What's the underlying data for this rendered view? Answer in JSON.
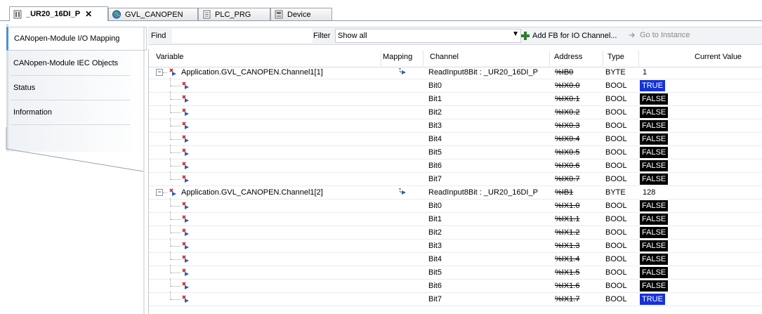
{
  "tabs": [
    {
      "label": "_UR20_16DI_P",
      "icon": "module-icon",
      "active": true,
      "close": "✕"
    },
    {
      "label": "GVL_CANOPEN",
      "icon": "globe-icon",
      "active": false
    },
    {
      "label": "PLC_PRG",
      "icon": "document-icon",
      "active": false
    },
    {
      "label": "Device",
      "icon": "device-icon",
      "active": false
    }
  ],
  "nav": {
    "items": [
      {
        "label": "CANopen-Module I/O Mapping",
        "active": true
      },
      {
        "label": "CANopen-Module IEC Objects",
        "active": false
      },
      {
        "label": "Status",
        "active": false
      },
      {
        "label": "Information",
        "active": false
      }
    ]
  },
  "toolbar": {
    "find_label": "Find",
    "find_value": "",
    "filter_label": "Filter",
    "filter_value": "Show all",
    "add_fb_label": "Add FB for IO Channel...",
    "goto_label": "Go to Instance"
  },
  "grid": {
    "columns": {
      "variable": "Variable",
      "mapping": "Mapping",
      "channel": "Channel",
      "address": "Address",
      "type": "Type",
      "current_value": "Current Value"
    },
    "rows": [
      {
        "variable": "Application.GVL_CANOPEN.Channel1[1]",
        "parent": true,
        "channel": "ReadInput8Bit : _UR20_16DI_P",
        "address": "%IB0",
        "type": "BYTE",
        "value": "1",
        "badge": ""
      },
      {
        "variable": "",
        "parent": false,
        "channel": "Bit0",
        "address": "%IX0.0",
        "type": "BOOL",
        "value": "TRUE",
        "badge": "true"
      },
      {
        "variable": "",
        "parent": false,
        "channel": "Bit1",
        "address": "%IX0.1",
        "type": "BOOL",
        "value": "FALSE",
        "badge": "false"
      },
      {
        "variable": "",
        "parent": false,
        "channel": "Bit2",
        "address": "%IX0.2",
        "type": "BOOL",
        "value": "FALSE",
        "badge": "false"
      },
      {
        "variable": "",
        "parent": false,
        "channel": "Bit3",
        "address": "%IX0.3",
        "type": "BOOL",
        "value": "FALSE",
        "badge": "false"
      },
      {
        "variable": "",
        "parent": false,
        "channel": "Bit4",
        "address": "%IX0.4",
        "type": "BOOL",
        "value": "FALSE",
        "badge": "false"
      },
      {
        "variable": "",
        "parent": false,
        "channel": "Bit5",
        "address": "%IX0.5",
        "type": "BOOL",
        "value": "FALSE",
        "badge": "false"
      },
      {
        "variable": "",
        "parent": false,
        "channel": "Bit6",
        "address": "%IX0.6",
        "type": "BOOL",
        "value": "FALSE",
        "badge": "false"
      },
      {
        "variable": "",
        "parent": false,
        "channel": "Bit7",
        "address": "%IX0.7",
        "type": "BOOL",
        "value": "FALSE",
        "badge": "false"
      },
      {
        "variable": "Application.GVL_CANOPEN.Channel1[2]",
        "parent": true,
        "channel": "ReadInput8Bit : _UR20_16DI_P",
        "address": "%IB1",
        "type": "BYTE",
        "value": "128",
        "badge": ""
      },
      {
        "variable": "",
        "parent": false,
        "channel": "Bit0",
        "address": "%IX1.0",
        "type": "BOOL",
        "value": "FALSE",
        "badge": "false"
      },
      {
        "variable": "",
        "parent": false,
        "channel": "Bit1",
        "address": "%IX1.1",
        "type": "BOOL",
        "value": "FALSE",
        "badge": "false"
      },
      {
        "variable": "",
        "parent": false,
        "channel": "Bit2",
        "address": "%IX1.2",
        "type": "BOOL",
        "value": "FALSE",
        "badge": "false"
      },
      {
        "variable": "",
        "parent": false,
        "channel": "Bit3",
        "address": "%IX1.3",
        "type": "BOOL",
        "value": "FALSE",
        "badge": "false"
      },
      {
        "variable": "",
        "parent": false,
        "channel": "Bit4",
        "address": "%IX1.4",
        "type": "BOOL",
        "value": "FALSE",
        "badge": "false"
      },
      {
        "variable": "",
        "parent": false,
        "channel": "Bit5",
        "address": "%IX1.5",
        "type": "BOOL",
        "value": "FALSE",
        "badge": "false"
      },
      {
        "variable": "",
        "parent": false,
        "channel": "Bit6",
        "address": "%IX1.6",
        "type": "BOOL",
        "value": "FALSE",
        "badge": "false"
      },
      {
        "variable": "",
        "parent": false,
        "channel": "Bit7",
        "address": "%IX1.7",
        "type": "BOOL",
        "value": "TRUE",
        "badge": "true"
      }
    ]
  },
  "colors": {
    "true_badge": "#1432d9",
    "false_badge": "#000000",
    "active_nav_accent": "#4a8fdc"
  }
}
